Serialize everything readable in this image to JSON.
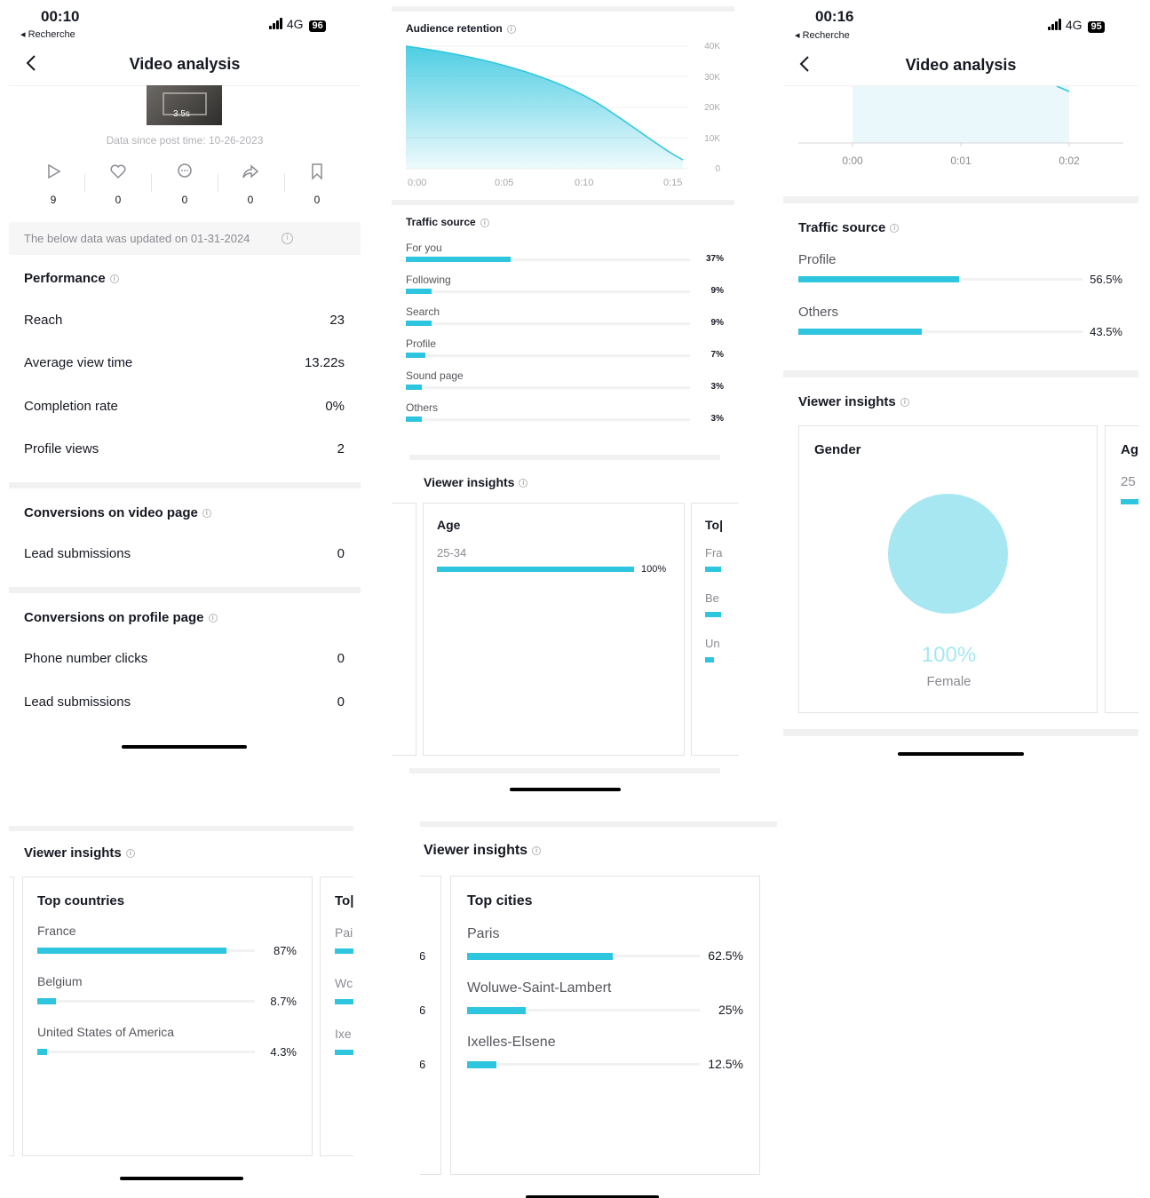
{
  "status_bar_1": {
    "time": "00:10",
    "back_label": "◂ Recherche",
    "network": "4G",
    "battery": "96"
  },
  "status_bar_3": {
    "time": "00:16",
    "back_label": "◂ Recherche",
    "network": "4G",
    "battery": "95"
  },
  "header": {
    "title": "Video analysis"
  },
  "thumbnail": {
    "duration": "3.5s"
  },
  "data_since": "Data since post time: 10-26-2023",
  "engagement": [
    {
      "icon": "play-icon",
      "value": "9"
    },
    {
      "icon": "heart-icon",
      "value": "0"
    },
    {
      "icon": "comment-icon",
      "value": "0"
    },
    {
      "icon": "share-icon",
      "value": "0"
    },
    {
      "icon": "bookmark-icon",
      "value": "0"
    }
  ],
  "updated_notice": "The below data was updated on 01-31-2024",
  "performance": {
    "title": "Performance",
    "rows": [
      {
        "label": "Reach",
        "value": "23"
      },
      {
        "label": "Average view time",
        "value": "13.22s"
      },
      {
        "label": "Completion rate",
        "value": "0%"
      },
      {
        "label": "Profile views",
        "value": "2"
      }
    ]
  },
  "conversions_video": {
    "title": "Conversions on video page",
    "rows": [
      {
        "label": "Lead submissions",
        "value": "0"
      }
    ]
  },
  "conversions_profile": {
    "title": "Conversions on profile page",
    "rows": [
      {
        "label": "Phone number clicks",
        "value": "0"
      },
      {
        "label": "Lead submissions",
        "value": "0"
      }
    ]
  },
  "audience_retention": {
    "title": "Audience retention",
    "y_ticks": [
      "40K",
      "30K",
      "20K",
      "10K",
      "0"
    ],
    "x_ticks": [
      "0:00",
      "0:05",
      "0:10",
      "0:15"
    ]
  },
  "traffic_source_2": {
    "title": "Traffic source",
    "items": [
      {
        "label": "For you",
        "value": "37%",
        "fraction": 0.37
      },
      {
        "label": "Following",
        "value": "9%",
        "fraction": 0.09
      },
      {
        "label": "Search",
        "value": "9%",
        "fraction": 0.09
      },
      {
        "label": "Profile",
        "value": "7%",
        "fraction": 0.07
      },
      {
        "label": "Sound page",
        "value": "3%",
        "fraction": 0.03
      },
      {
        "label": "Others",
        "value": "3%",
        "fraction": 0.03
      }
    ]
  },
  "viewer_insights_title": "Viewer insights",
  "age_card": {
    "title": "Age",
    "label": "25-34",
    "value": "100%",
    "fraction": 1.0
  },
  "partial_card_2": {
    "title": "To|",
    "items": [
      "Fra",
      "Be",
      "Un"
    ]
  },
  "retention_zoom": {
    "x_ticks": [
      "0:00",
      "0:01",
      "0:02"
    ]
  },
  "traffic_source_3": {
    "title": "Traffic source",
    "items": [
      {
        "label": "Profile",
        "value": "56.5%",
        "fraction": 0.565
      },
      {
        "label": "Others",
        "value": "43.5%",
        "fraction": 0.435
      }
    ]
  },
  "gender_card": {
    "title": "Gender",
    "value": "100%",
    "label": "Female"
  },
  "partial_card_3": {
    "title": "Ag",
    "label": "25"
  },
  "countries_card": {
    "title": "Top countries",
    "items": [
      {
        "label": "France",
        "value": "87%",
        "fraction": 0.87
      },
      {
        "label": "Belgium",
        "value": "8.7%",
        "fraction": 0.087
      },
      {
        "label": "United States of America",
        "value": "4.3%",
        "fraction": 0.043
      }
    ]
  },
  "partial_card_4": {
    "title": "To|",
    "items": [
      "Pai",
      "Wc",
      "Ixe"
    ]
  },
  "cities_card": {
    "title": "Top cities",
    "items": [
      {
        "label": "Paris",
        "value": "62.5%",
        "fraction": 0.625
      },
      {
        "label": "Woluwe-Saint-Lambert",
        "value": "25%",
        "fraction": 0.25
      },
      {
        "label": "Ixelles-Elsene",
        "value": "12.5%",
        "fraction": 0.125
      }
    ]
  },
  "partial_left_5": [
    "6",
    "6",
    "6"
  ],
  "colors": {
    "accent": "#2ec5de",
    "pie": "#a6e7f2",
    "track": "#f1f1f2"
  }
}
